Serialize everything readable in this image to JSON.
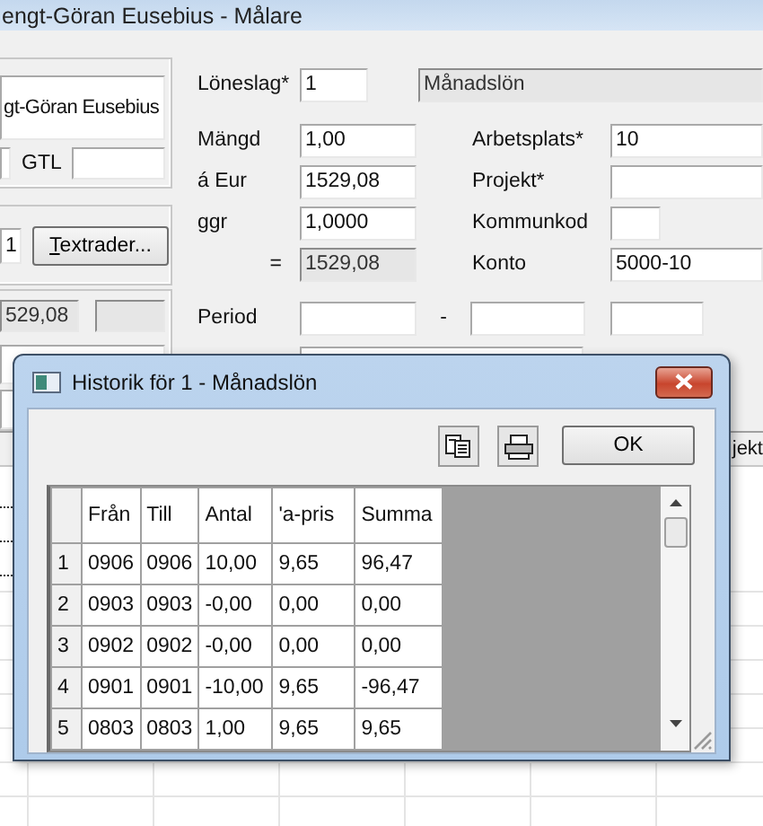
{
  "window": {
    "title": "engt-Göran Eusebius - Målare"
  },
  "employee": {
    "name": "gt-Göran Eusebius",
    "code": "GTL"
  },
  "text_panel": {
    "number": "1",
    "button": "Textrader..."
  },
  "amount_panel": {
    "value": "529,08"
  },
  "form": {
    "loneslag_label": "Löneslag*",
    "loneslag": "1",
    "loneslag_name": "Månadslön",
    "rows": [
      {
        "label": "Mängd",
        "value": "1,00",
        "readonly": false,
        "label_2": "Arbetsplats*",
        "value_2": "10",
        "wide_2": true
      },
      {
        "label": "á Eur",
        "value": "1529,08",
        "readonly": false,
        "label_2": "Projekt*",
        "value_2": "",
        "wide_2": true
      },
      {
        "label": "ggr",
        "value": "1,0000",
        "readonly": false,
        "label_2": "Kommunkod",
        "value_2": "",
        "wide_2": false
      },
      {
        "label": "=",
        "value": "1529,08",
        "readonly": true,
        "label_2": "Konto",
        "value_2": "5000-10",
        "wide_2": true
      }
    ],
    "period_label": "Period",
    "period_separator": "-"
  },
  "list": {
    "column_header": "jekt"
  },
  "dialog": {
    "title": "Historik för 1 - Månadslön",
    "ok": "OK",
    "columns": [
      "Från",
      "Till",
      "Antal",
      "'a-pris",
      "Summa"
    ],
    "rows": [
      {
        "num": "1",
        "cells": [
          "0906",
          "0906",
          "10,00",
          "9,65",
          "96,47"
        ]
      },
      {
        "num": "2",
        "cells": [
          "0903",
          "0903",
          "-0,00",
          "0,00",
          "0,00"
        ]
      },
      {
        "num": "3",
        "cells": [
          "0902",
          "0902",
          "-0,00",
          "0,00",
          "0,00"
        ]
      },
      {
        "num": "4",
        "cells": [
          "0901",
          "0901",
          "-10,00",
          "9,65",
          "-96,47"
        ]
      },
      {
        "num": "5",
        "cells": [
          "0803",
          "0803",
          "1,00",
          "9,65",
          "9,65"
        ]
      }
    ]
  }
}
